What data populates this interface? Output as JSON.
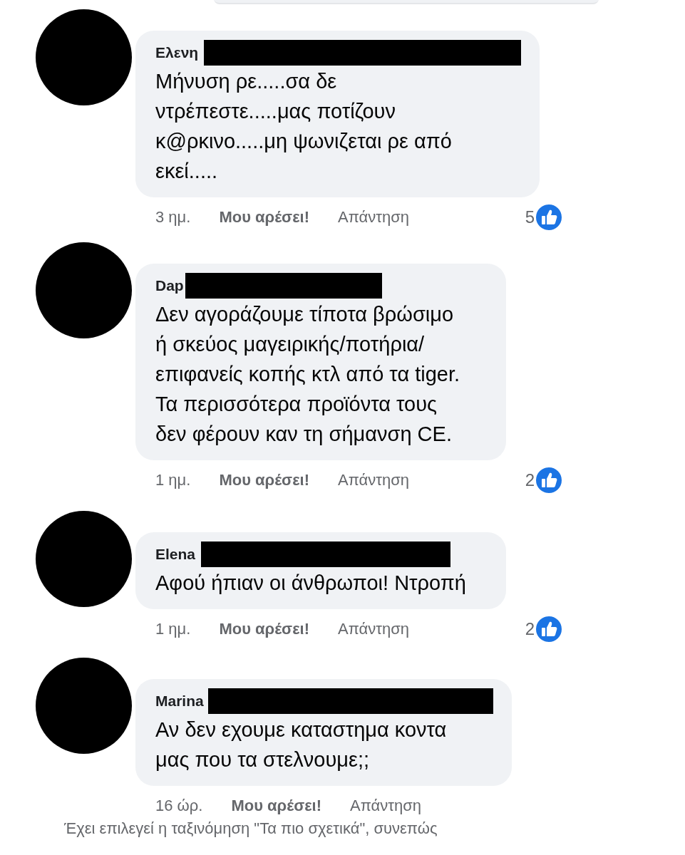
{
  "comments": [
    {
      "author": "Ελενη",
      "text": "Μήνυση ρε.....σα δε\nντρέπεστε.....μας ποτίζουν\nκ@ρκινο.....μη ψωνιζεται ρε από\nεκεί.....",
      "time": "3 ημ.",
      "like": "Μου αρέσει!",
      "reply": "Απάντηση",
      "reactions": "5"
    },
    {
      "author": "Dap",
      "text": "Δεν αγοράζουμε τίποτα βρώσιμο\nή σκεύος μαγειρικής/ποτήρια/\nεπιφανείς κοπής κτλ από τα tiger.\nΤα περισσότερα προϊόντα τους\nδεν φέρουν καν τη σήμανση CE.",
      "time": "1 ημ.",
      "like": "Μου αρέσει!",
      "reply": "Απάντηση",
      "reactions": "2"
    },
    {
      "author": "Elena",
      "text": "Αφού ήπιαν οι άνθρωποι! Ντροπή",
      "time": "1 ημ.",
      "like": "Μου αρέσει!",
      "reply": "Απάντηση",
      "reactions": "2"
    },
    {
      "author": "Marina",
      "text": "Αν δεν εχουμε καταστημα κοντα\nμας που τα στελνουμε;;",
      "time": "16 ώρ.",
      "like": "Μου αρέσει!",
      "reply": "Απάντηση"
    }
  ],
  "footer": "Έχει επιλεγεί η ταξινόμηση \"Τα πιο σχετικά\", συνεπώς"
}
